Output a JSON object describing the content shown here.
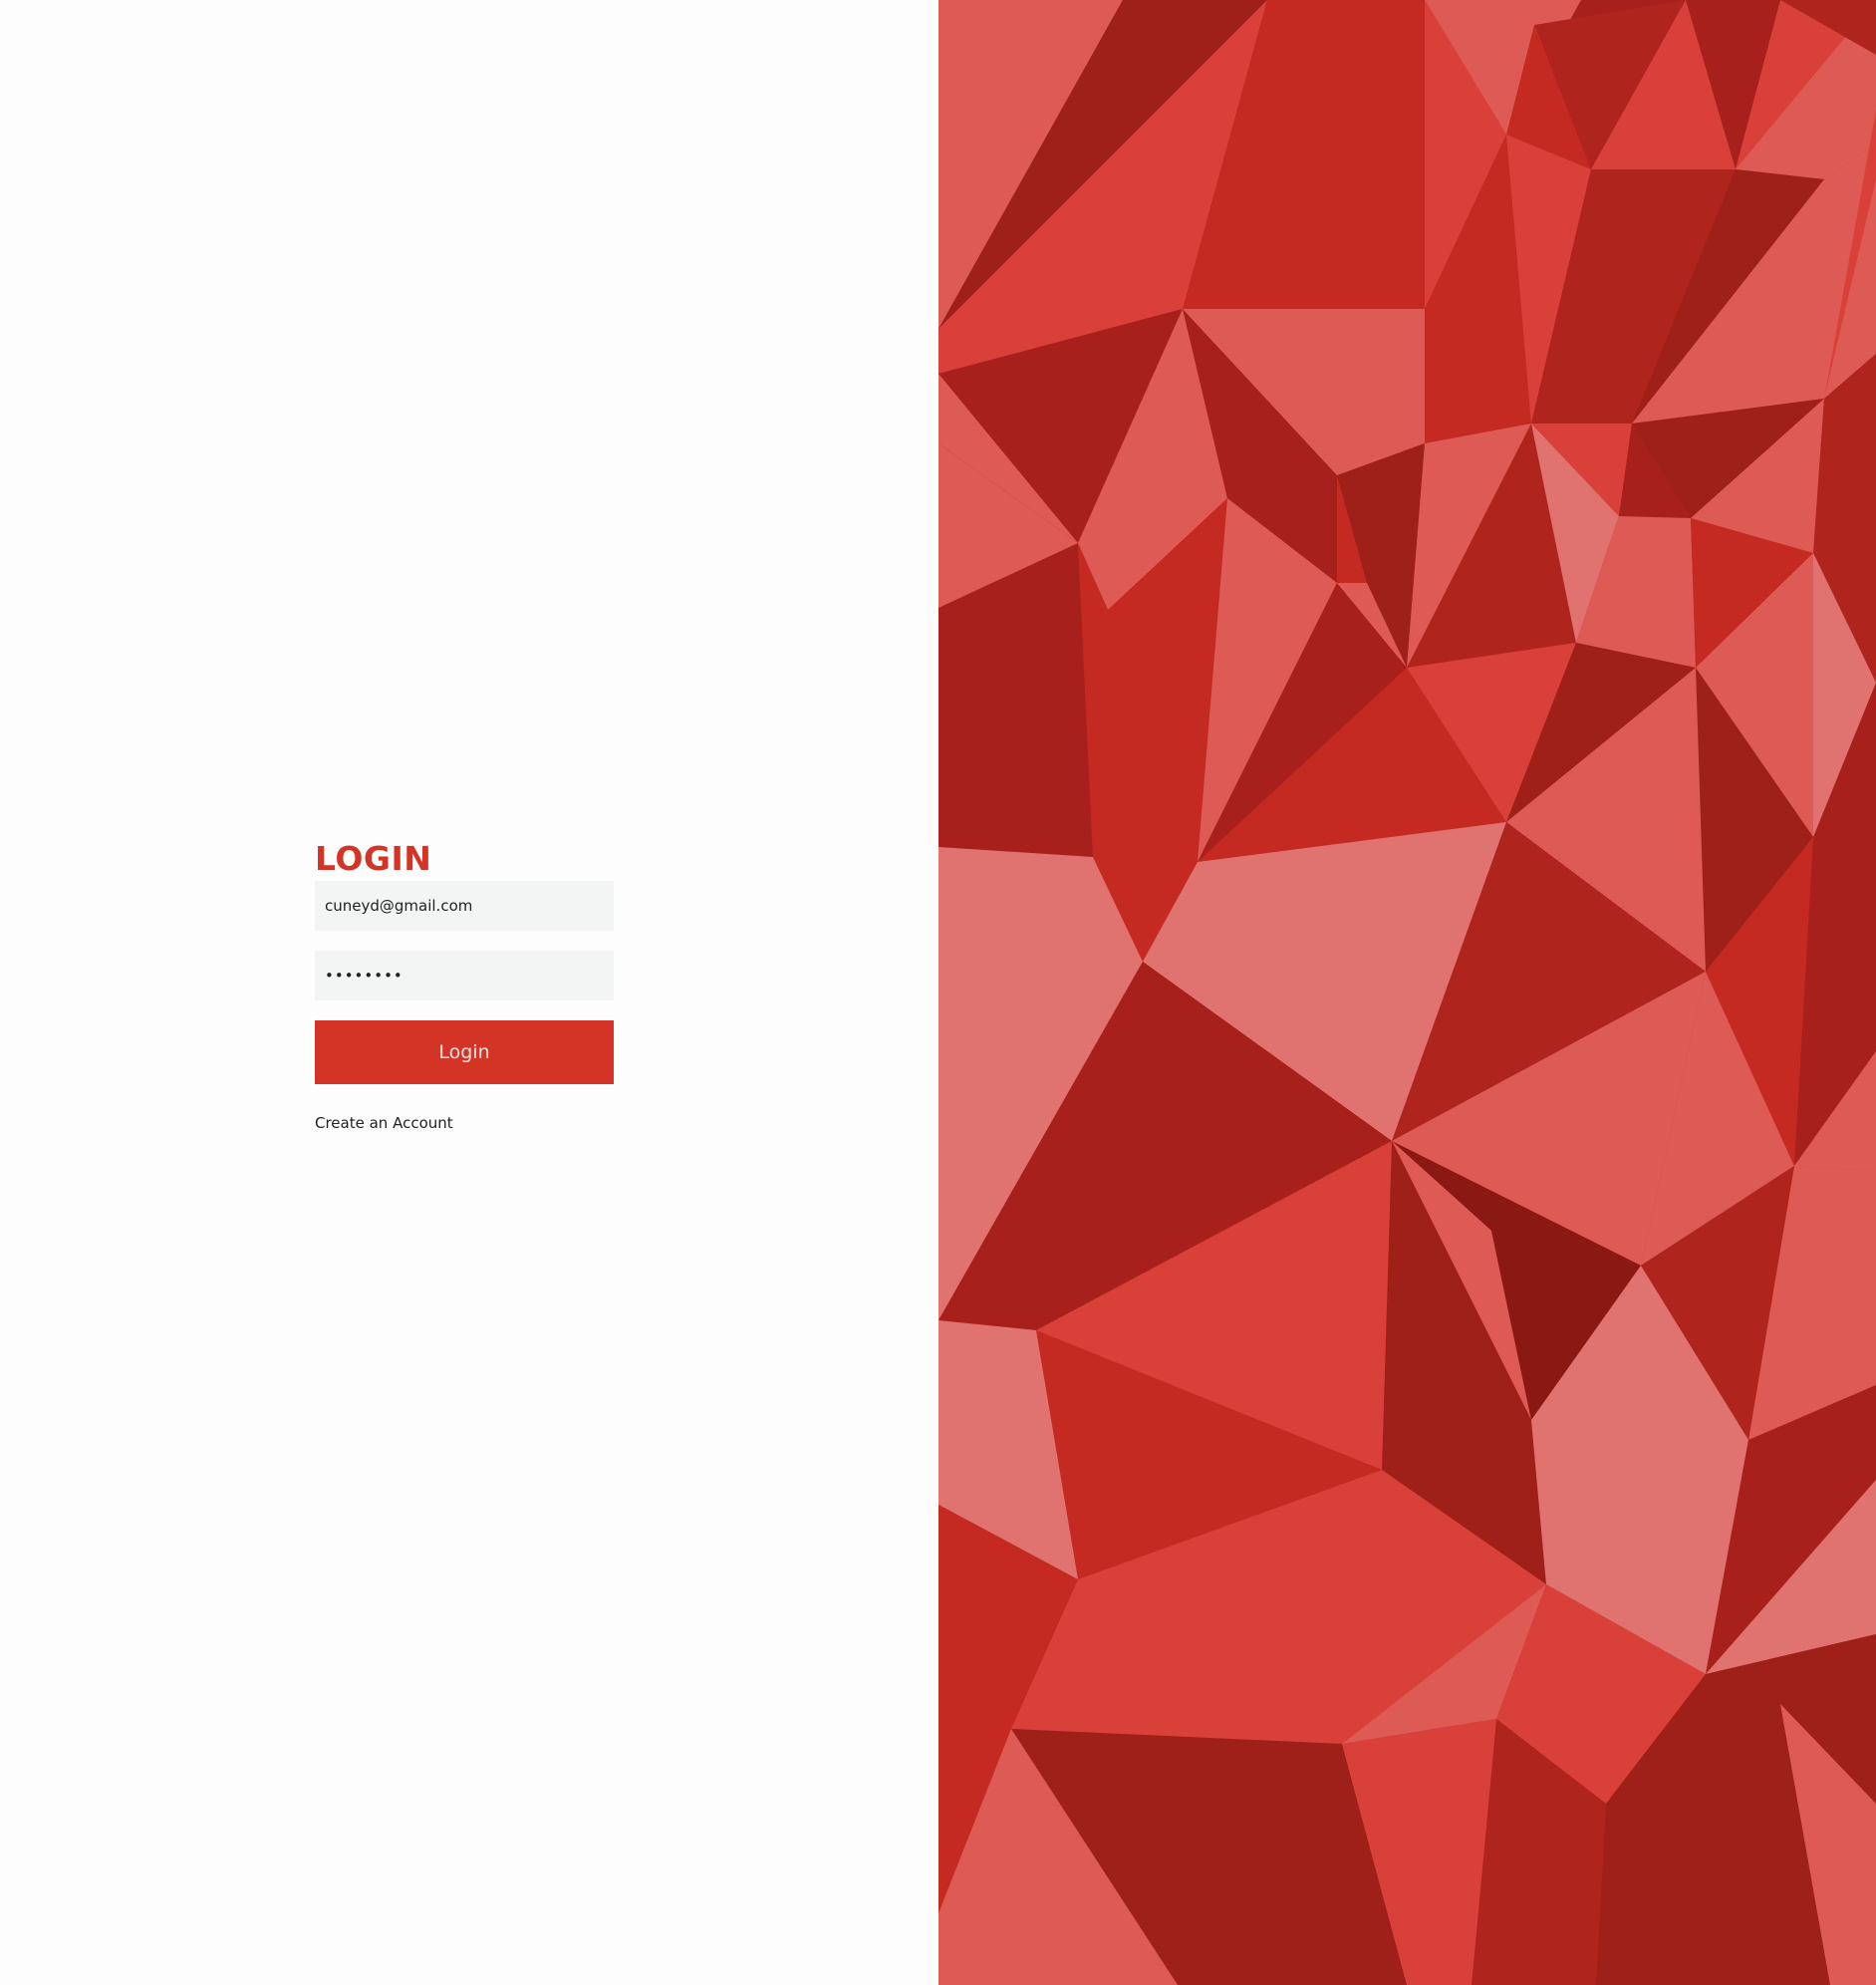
{
  "login": {
    "title": "LOGIN",
    "email_value": "cuneyd@gmail.com",
    "password_value": "password",
    "button_label": "Login",
    "create_account_label": "Create an Account"
  },
  "colors": {
    "accent": "#d43426",
    "input_background": "#f3f4f4",
    "page_background": "#fdfdfd",
    "pattern_base": "#c42a22"
  }
}
